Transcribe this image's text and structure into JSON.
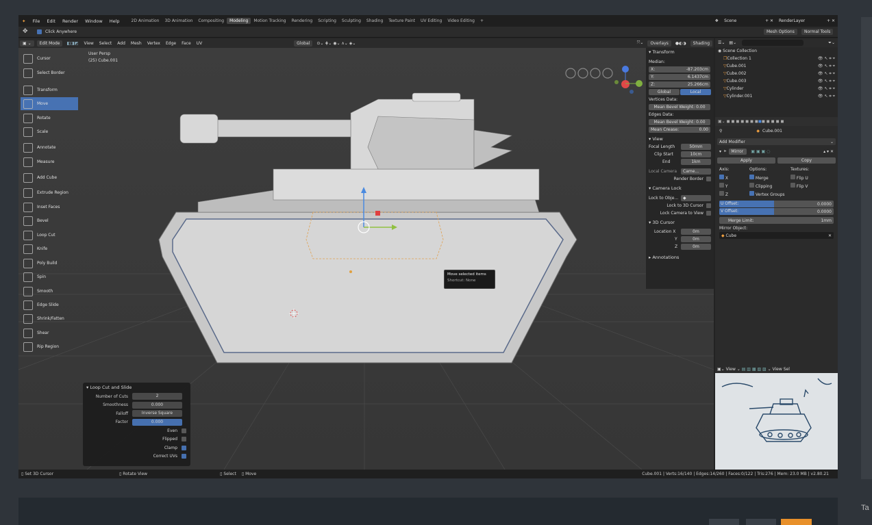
{
  "topbar": {
    "menus": [
      "File",
      "Edit",
      "Render",
      "Window",
      "Help"
    ],
    "workspaces": [
      "2D Animation",
      "3D Animation",
      "Compositing",
      "Modeling",
      "Motion Tracking",
      "Rendering",
      "Scripting",
      "Sculpting",
      "Shading",
      "Texture Paint",
      "UV Editing",
      "Video Editing"
    ],
    "active_workspace": "Modeling",
    "add": "+",
    "scene": "Scene",
    "render_layer": "RenderLayer"
  },
  "toolsettings": {
    "click_anywhere": "Click Anywhere",
    "mesh_options": "Mesh Options",
    "normal_tools": "Normal Tools"
  },
  "vheader": {
    "mode": "Edit Mode",
    "menus": [
      "View",
      "Select",
      "Add",
      "Mesh",
      "Vertex",
      "Edge",
      "Face",
      "UV"
    ],
    "orientation": "Global",
    "overlays": "Overlays",
    "shading": "Shading"
  },
  "viewport": {
    "persp": "User Persp",
    "object": "(25) Cube.001"
  },
  "tools": [
    "Cursor",
    "Select Border",
    "Transform",
    "Move",
    "Rotate",
    "Scale",
    "Annotate",
    "Measure",
    "Add Cube",
    "Extrude Region",
    "Inset Faces",
    "Bevel",
    "Loop Cut",
    "Knife",
    "Poly Build",
    "Spin",
    "Smooth",
    "Edge Slide",
    "Shrink/Fatten",
    "Shear",
    "Rip Region"
  ],
  "active_tool": "Move",
  "npanel": {
    "transform": "Transform",
    "median": "Median:",
    "coords": [
      {
        "l": "X:",
        "v": "-87.203cm"
      },
      {
        "l": "Y:",
        "v": "6.1437cm"
      },
      {
        "l": "Z:",
        "v": "25.266cm"
      }
    ],
    "global": "Global",
    "local": "Local",
    "vertices_data": "Vertices Data:",
    "mean_bevel_weight_v": "Mean Bevel Weight: 0.00",
    "edges_data": "Edges Data:",
    "mean_bevel_weight_e": "Mean Bevel Weight: 0.00",
    "mean_crease": "Mean Crease:",
    "mean_crease_val": "0.00",
    "view": "View",
    "focal_length": "Focal Length",
    "focal_val": "50mm",
    "clip_start": "Clip Start",
    "clip_start_val": "10cm",
    "end": "End",
    "end_val": "1km",
    "local_camera": "Local Camera",
    "camera_field": "Came...",
    "render_border": "Render Border",
    "camera_lock": "Camera Lock",
    "lock_to_obj": "Lock to Obje...",
    "lock_3d_cursor": "Lock to 3D Cursor",
    "lock_camera_to_view": "Lock Camera to View",
    "cursor3d": "3D Cursor",
    "location_x": "Location X",
    "y": "Y",
    "z": "Z",
    "cx": "0m",
    "cy": "0m",
    "cz": "0m",
    "annotations": "Annotations"
  },
  "outliner": {
    "scene_collection": "Scene Collection",
    "items": [
      "Collection 1",
      "Cube.001",
      "Cube.002",
      "Cube.003",
      "Cylinder",
      "Cylinder.001"
    ]
  },
  "props": {
    "object": "Cube.001",
    "add_modifier": "Add Modifier",
    "modifier": "Mirror",
    "apply": "Apply",
    "copy": "Copy",
    "axis": "Axis:",
    "options": "Options:",
    "textures": "Textures:",
    "x": "X",
    "y": "Y",
    "z": "Z",
    "merge": "Merge",
    "clipping": "Clipping",
    "vertex_groups": "Vertex Groups",
    "flip_u": "Flip U",
    "flip_v": "Flip V",
    "u_offset": "U Offset:",
    "u_val": "0.0000",
    "v_offset": "V Offset:",
    "v_val": "0.0000",
    "merge_limit": "Merge Limit:",
    "merge_val": "1mm",
    "mirror_object": "Mirror Object:",
    "mirror_obj_val": "Cube"
  },
  "imgeditor": {
    "view": "View",
    "view2": "View",
    "sel": "Sel"
  },
  "lastop": {
    "title": "Loop Cut and Slide",
    "rows": [
      {
        "l": "Number of Cuts",
        "v": "2"
      },
      {
        "l": "Smoothness",
        "v": "0.000"
      },
      {
        "l": "Falloff",
        "v": "Inverse Square"
      },
      {
        "l": "Factor",
        "v": "0.000"
      }
    ],
    "checks": [
      {
        "l": "Even",
        "on": false
      },
      {
        "l": "Flipped",
        "on": false
      },
      {
        "l": "Clamp",
        "on": true
      },
      {
        "l": "Correct UVs",
        "on": true
      }
    ]
  },
  "tooltip": {
    "title": "Move selected items",
    "shortcut": "Shortcut: None"
  },
  "status": {
    "a": "Set 3D Cursor",
    "b": "Rotate View",
    "c": "Select",
    "d": "Move",
    "info": "Cube.001 | Verts:16/140 | Edges:14/260 | Faces:0/122 | Tris:276 | Mem: 23.0 MB | v2.80.21"
  },
  "bottom": {
    "text": "Ta"
  }
}
